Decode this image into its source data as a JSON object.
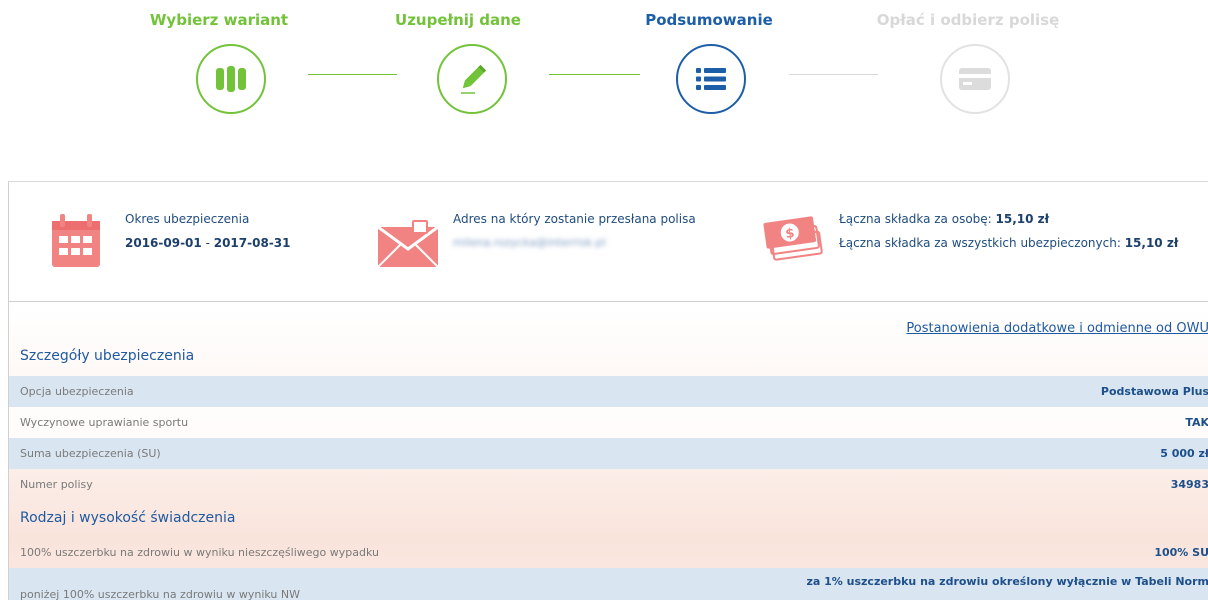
{
  "stepper": {
    "steps": [
      {
        "label": "Wybierz wariant",
        "icon": "columns-icon",
        "state": "done",
        "color": "#72c33a"
      },
      {
        "label": "Uzupełnij dane",
        "icon": "pencil-icon",
        "state": "done",
        "color": "#72c33a"
      },
      {
        "label": "Podsumowanie",
        "icon": "list-icon",
        "state": "active",
        "color": "#1d5ea8"
      },
      {
        "label": "Opłać i odbierz polisę",
        "icon": "credit-card-icon",
        "state": "pending",
        "color": "#d8d8d8"
      }
    ]
  },
  "summary": {
    "period_label": "Okres ubezpieczenia",
    "period_start": "2016-09-01",
    "period_sep": " - ",
    "period_end": "2017-08-31",
    "address_label": "Adres na który zostanie przesłana polisa",
    "address_value": "milena.rozycka@interrisk.pl",
    "premium_person_label": "Łączna składka za osobę: ",
    "premium_person_value": "15,10 zł",
    "premium_all_label": "Łączna składka za wszystkich ubezpieczonych: ",
    "premium_all_value": "15,10 zł",
    "icon_color": "#f28383"
  },
  "details": {
    "owu_link": "Postanowienia dodatkowe i odmienne od OWU",
    "section_title": "Szczegóły ubezpieczenia",
    "rows": [
      {
        "label": "Opcja ubezpieczenia",
        "value": "Podstawowa Plus"
      },
      {
        "label": "Wyczynowe uprawianie sportu",
        "value": "TAK"
      },
      {
        "label": "Suma ubezpieczenia (SU)",
        "value": "5 000 zł"
      },
      {
        "label": "Numer polisy",
        "value": "34983"
      }
    ],
    "benefits_title": "Rodzaj i wysokość świadczenia",
    "benefit_rows": [
      {
        "label": "100% uszczerbku na zdrowiu w wyniku nieszczęśliwego wypadku",
        "value": "100% SU"
      },
      {
        "label": "poniżej 100% uszczerbku na zdrowiu w wyniku NW",
        "value": "za 1% uszczerbku na zdrowiu określony wyłącznie w Tabeli Norm"
      }
    ]
  }
}
